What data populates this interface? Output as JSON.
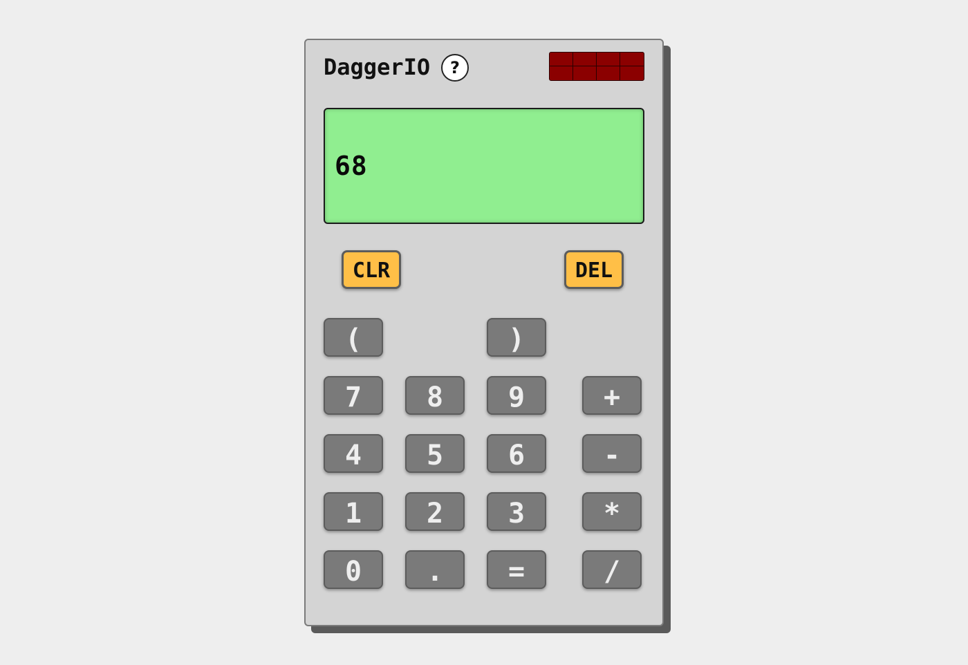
{
  "app": {
    "title": "DaggerIO",
    "help_label": "?"
  },
  "display": {
    "value": "68"
  },
  "colors": {
    "body": "#d4d4d4",
    "display": "#90ee90",
    "key": "#7a7a7a",
    "func_key": "#ffbf47",
    "solar_panel": "#8b0000"
  },
  "keys": {
    "clr": "CLR",
    "del": "DEL",
    "lparen": "(",
    "rparen": ")",
    "k7": "7",
    "k8": "8",
    "k9": "9",
    "plus": "+",
    "k4": "4",
    "k5": "5",
    "k6": "6",
    "minus": "-",
    "k1": "1",
    "k2": "2",
    "k3": "3",
    "multiply": "*",
    "k0": "0",
    "dot": ".",
    "equals": "=",
    "divide": "/"
  }
}
